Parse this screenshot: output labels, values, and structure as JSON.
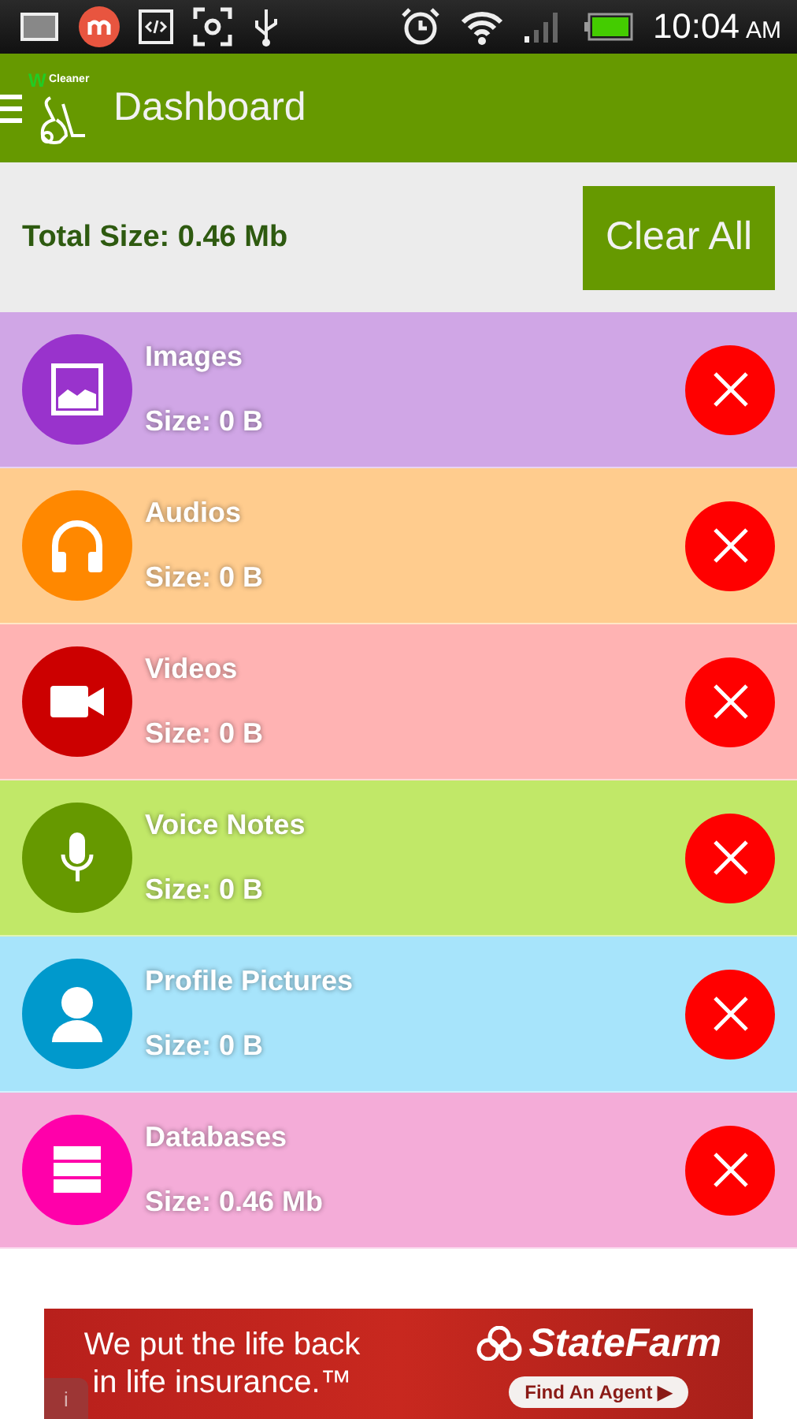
{
  "status_bar": {
    "time": "10:04",
    "ampm": "AM"
  },
  "app_bar": {
    "logo_letter": "W",
    "logo_word": "Cleaner",
    "title": "Dashboard"
  },
  "summary": {
    "total": "Total Size: 0.46 Mb",
    "clear_button": "Clear All"
  },
  "categories": [
    {
      "kind": "images",
      "name": "Images",
      "size": "Size: 0 B",
      "color": "#9933cc"
    },
    {
      "kind": "audios",
      "name": "Audios",
      "size": "Size: 0 B",
      "color": "#ff8800"
    },
    {
      "kind": "videos",
      "name": "Videos",
      "size": "Size: 0 B",
      "color": "#cc0000"
    },
    {
      "kind": "voice",
      "name": "Voice Notes",
      "size": "Size: 0 B",
      "color": "#669900"
    },
    {
      "kind": "profile",
      "name": "Profile Pictures",
      "size": "Size: 0 B",
      "color": "#0099cc"
    },
    {
      "kind": "databases",
      "name": "Databases",
      "size": "Size: 0.46 Mb",
      "color": "#ff00aa"
    }
  ],
  "ad": {
    "headline": "We put the life back in life insurance.™",
    "brand": "StateFarm",
    "action": "Find An Agent ▶",
    "info": "i"
  }
}
